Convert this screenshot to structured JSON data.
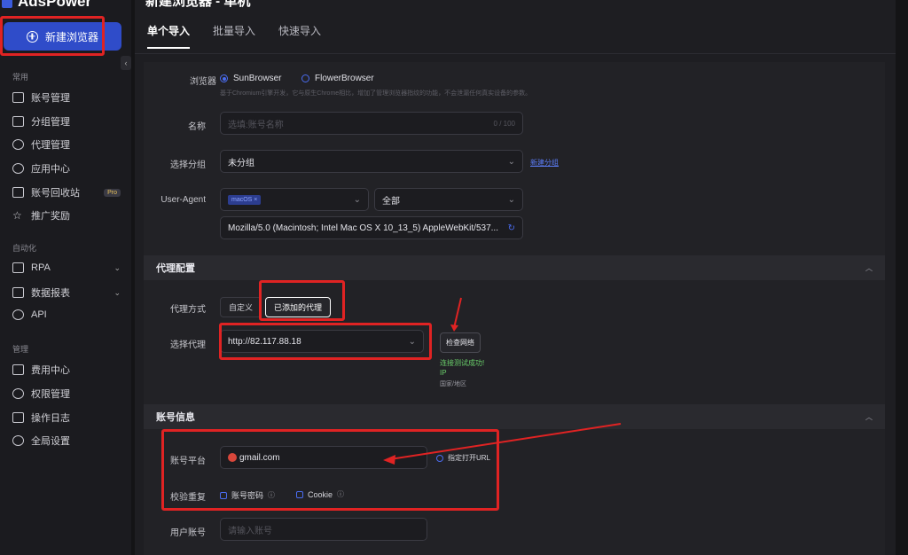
{
  "app": {
    "logo_text": "AdsPower",
    "page_title": "新建浏览器 - 单机"
  },
  "sidebar": {
    "new_button": "新建浏览器",
    "sections": {
      "common": "常用",
      "automation": "自动化",
      "manage": "管理"
    },
    "common_items": [
      {
        "label": "账号管理",
        "icon": "folder-icon"
      },
      {
        "label": "分组管理",
        "icon": "folder-group-icon"
      },
      {
        "label": "代理管理",
        "icon": "proxy-icon"
      },
      {
        "label": "应用中心",
        "icon": "app-center-icon"
      },
      {
        "label": "账号回收站",
        "icon": "trash-icon",
        "badge": "Pro"
      },
      {
        "label": "推广奖励",
        "icon": "star-icon"
      }
    ],
    "automation_items": [
      {
        "label": "RPA",
        "icon": "rpa-icon"
      },
      {
        "label": "数据报表",
        "icon": "report-icon"
      },
      {
        "label": "API",
        "icon": "api-icon"
      }
    ],
    "manage_items": [
      {
        "label": "费用中心",
        "icon": "billing-icon"
      },
      {
        "label": "权限管理",
        "icon": "permission-icon"
      },
      {
        "label": "操作日志",
        "icon": "log-icon"
      },
      {
        "label": "全局设置",
        "icon": "settings-icon"
      }
    ]
  },
  "tabs": [
    "单个导入",
    "批量导入",
    "快速导入"
  ],
  "form": {
    "browser": {
      "label": "浏览器",
      "option1": "SunBrowser",
      "option2": "FlowerBrowser",
      "hint": "基于Chromium引擎开发，它与原生Chrome相比，增加了管理浏览器指纹的功能，不会泄漏任何真实设备的参数。"
    },
    "name": {
      "label": "名称",
      "placeholder": "选填:账号名称",
      "counter": "0 / 100"
    },
    "group": {
      "label": "选择分组",
      "value": "未分组",
      "link": "新建分组"
    },
    "ua": {
      "label": "User-Agent",
      "os_tag": "macOS ×",
      "version": "全部",
      "value": "Mozilla/5.0 (Macintosh; Intel Mac OS X 10_13_5) AppleWebKit/537..."
    },
    "proxy_section": "代理配置",
    "proxy_mode": {
      "label": "代理方式",
      "opt1": "自定义",
      "opt2": "已添加的代理"
    },
    "proxy_select": {
      "label": "选择代理",
      "value": "http://82.117.88.18",
      "check_button": "检查网络",
      "status": "连接测试成功!",
      "status_line2": "IP",
      "country": "国家/地区"
    },
    "account_section": "账号信息",
    "platform": {
      "label": "账号平台",
      "value": "gmail.com",
      "option": "指定打开URL"
    },
    "dedupe": {
      "label": "校验重复",
      "opt1": "账号密码",
      "opt2": "Cookie"
    },
    "user_account": {
      "label": "用户账号",
      "placeholder": "请输入账号"
    }
  }
}
